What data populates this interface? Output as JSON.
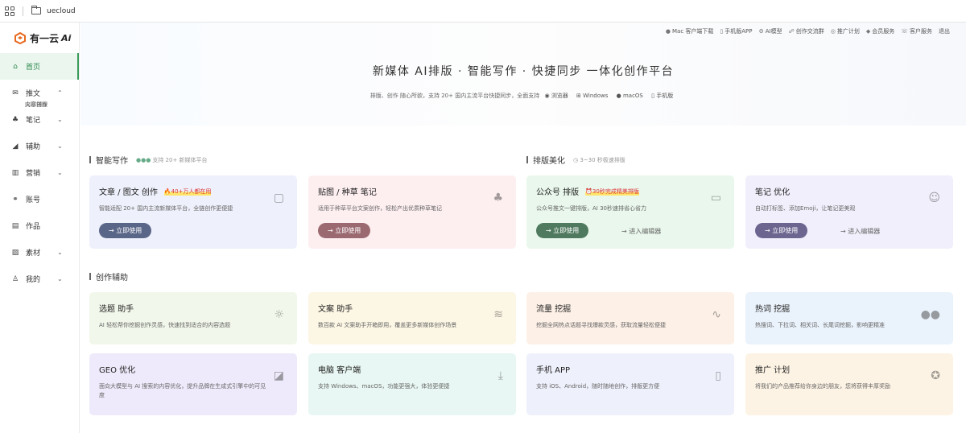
{
  "browser": {
    "url": "uecloud"
  },
  "logo": {
    "text": "有一云"
  },
  "sidebar": {
    "items": [
      {
        "label": "首页"
      },
      {
        "label": "推文"
      },
      {
        "label": "文章创作"
      },
      {
        "label": "内容排版"
      },
      {
        "label": "笔记"
      },
      {
        "label": "辅助"
      },
      {
        "label": "营销"
      },
      {
        "label": "账号"
      },
      {
        "label": "作品"
      },
      {
        "label": "素材"
      },
      {
        "label": "我的"
      }
    ]
  },
  "toplinks": [
    "Mac 客户端下载",
    "手机版APP",
    "AI模型",
    "创作交流群",
    "推广计划",
    "会员服务",
    "客户服务",
    "退出"
  ],
  "hero": {
    "title": "新媒体 AI排版 · 智能写作 · 快捷同步 一体化创作平台",
    "subtitle": "排版、创作 随心所欲，支持 20+ 国内主流平台快捷同步，全面支持",
    "platforms": [
      "浏览器",
      "Windows",
      "macOS",
      "手机版"
    ]
  },
  "sections": {
    "writing": {
      "title": "智能写作",
      "note": "支持 20+ 新媒体平台"
    },
    "layout": {
      "title": "排版美化",
      "note": "3~30 秒极速排版"
    },
    "assist": {
      "title": "创作辅助"
    }
  },
  "cards": [
    {
      "title": "文章 / 图文 创作",
      "badge": "40+万人都在用",
      "desc": "智能适配 20+ 国内主流新媒体平台，全链创作更便捷",
      "btn": "立即使用"
    },
    {
      "title": "贴图 / 种草 笔记",
      "desc": "适用于种草平台文案创作，轻松产出优质种草笔记",
      "btn": "立即使用"
    },
    {
      "title": "公众号 排版",
      "badge": "30秒完成精美排版",
      "desc": "公众号推文一键排版，AI 30秒速排省心省力",
      "btn": "立即使用",
      "btn2": "进入编辑器"
    },
    {
      "title": "笔记 优化",
      "desc": "自动打标签、添加Emoji，让笔记更美观",
      "btn": "立即使用",
      "btn2": "进入编辑器"
    },
    {
      "title": "选题 助手",
      "desc": "AI 轻松帮你挖掘创作灵感，快速找到适合的内容选题"
    },
    {
      "title": "文案 助手",
      "desc": "数百款 AI 文案助手开箱即用，覆盖更多新媒体创作场景"
    },
    {
      "title": "流量 挖掘",
      "desc": "挖掘全网热点话题寻找爆款灵感，获取流量轻松便捷"
    },
    {
      "title": "热词 挖掘",
      "desc": "热搜词、下拉词、相关词、长尾词挖掘，影响更精准"
    },
    {
      "title": "GEO 优化",
      "desc": "面向大模型与 AI 搜索的内容优化，提升品牌在生成式引擎中的可见度"
    },
    {
      "title": "电脑 客户端",
      "desc": "支持 Windows、macOS，功能更强大，体验更便捷"
    },
    {
      "title": "手机 APP",
      "desc": "支持 iOS、Android，随时随地创作，排版更方便"
    },
    {
      "title": "推广 计划",
      "desc": "将我们的产品推荐给你身边的朋友，您将获得丰厚奖励"
    }
  ],
  "colors": {
    "accent": "#3a9a5a",
    "btn1": "#5a6688",
    "btn2": "#9b6a70",
    "btn3": "#4f7a5f",
    "btn4": "#6b6590"
  }
}
